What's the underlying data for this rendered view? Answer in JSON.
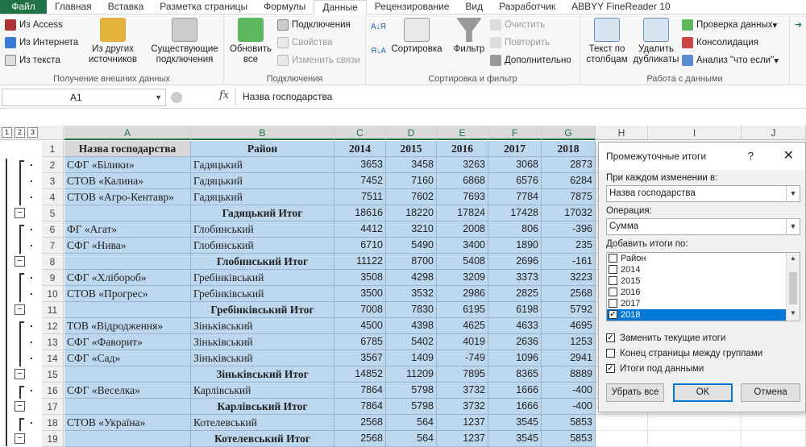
{
  "tabs": [
    "Файл",
    "Главная",
    "Вставка",
    "Разметка страницы",
    "Формулы",
    "Данные",
    "Рецензирование",
    "Вид",
    "Разработчик",
    "ABBYY FineReader 10"
  ],
  "ribbon": {
    "group1": {
      "label": "Получение внешних данных",
      "access": "Из Access",
      "internet": "Из Интернета",
      "text": "Из текста",
      "other": "Из других источников",
      "existing": "Существующие подключения"
    },
    "group2": {
      "label": "Подключения",
      "refresh": "Обновить все",
      "connections": "Подключения",
      "properties": "Свойства",
      "edit_links": "Изменить связи"
    },
    "group3": {
      "label": "Сортировка и фильтр",
      "sort": "Сортировка",
      "filter": "Фильтр",
      "clear": "Очистить",
      "reapply": "Повторить",
      "advanced": "Дополнительно"
    },
    "group4": {
      "label": "Работа с данными",
      "text_to_cols": "Текст по столбцам",
      "remove_dups": "Удалить дубликаты",
      "validation": "Проверка данных",
      "consolidate": "Консолидация",
      "whatif": "Анализ \"что если\""
    }
  },
  "formula_bar": {
    "name_box": "A1",
    "fx": "fx",
    "value": "Назва господарства"
  },
  "outline_levels": [
    "1",
    "2",
    "3"
  ],
  "columns": [
    "A",
    "B",
    "C",
    "D",
    "E",
    "F",
    "G",
    "H",
    "I",
    "J"
  ],
  "header_row": {
    "num": "1",
    "cells": [
      "Назва господарства",
      "Район",
      "2014",
      "2015",
      "2016",
      "2017",
      "2018"
    ]
  },
  "rows": [
    {
      "num": "2",
      "a": "СФГ «Білики»",
      "b": "Гадяцький",
      "v": [
        "3653",
        "3458",
        "3263",
        "3068",
        "2873"
      ],
      "total": false
    },
    {
      "num": "3",
      "a": "СТОВ «Калина»",
      "b": "Гадяцький",
      "v": [
        "7452",
        "7160",
        "6868",
        "6576",
        "6284"
      ],
      "total": false
    },
    {
      "num": "4",
      "a": "СТОВ «Агро-Кентавр»",
      "b": "Гадяцький",
      "v": [
        "7511",
        "7602",
        "7693",
        "7784",
        "7875"
      ],
      "total": false
    },
    {
      "num": "5",
      "a": "",
      "b": "Гадяцький Итог",
      "v": [
        "18616",
        "18220",
        "17824",
        "17428",
        "17032"
      ],
      "total": true
    },
    {
      "num": "6",
      "a": "ФГ «Агат»",
      "b": "Глобинський",
      "v": [
        "4412",
        "3210",
        "2008",
        "806",
        "-396"
      ],
      "total": false
    },
    {
      "num": "7",
      "a": "СФГ «Нива»",
      "b": "Глобинський",
      "v": [
        "6710",
        "5490",
        "3400",
        "1890",
        "235"
      ],
      "total": false
    },
    {
      "num": "8",
      "a": "",
      "b": "Глобинський Итог",
      "v": [
        "11122",
        "8700",
        "5408",
        "2696",
        "-161"
      ],
      "total": true
    },
    {
      "num": "9",
      "a": "СФГ «Хлібороб»",
      "b": "Гребінківський",
      "v": [
        "3508",
        "4298",
        "3209",
        "3373",
        "3223"
      ],
      "total": false
    },
    {
      "num": "10",
      "a": "СТОВ «Прогрес»",
      "b": "Гребінківський",
      "v": [
        "3500",
        "3532",
        "2986",
        "2825",
        "2568"
      ],
      "total": false
    },
    {
      "num": "11",
      "a": "",
      "b": "Гребінківський Итог",
      "v": [
        "7008",
        "7830",
        "6195",
        "6198",
        "5792"
      ],
      "total": true
    },
    {
      "num": "12",
      "a": "ТОВ «Відродження»",
      "b": "Зіньківський",
      "v": [
        "4500",
        "4398",
        "4625",
        "4633",
        "4695"
      ],
      "total": false
    },
    {
      "num": "13",
      "a": "СФГ «Фаворит»",
      "b": "Зіньківський",
      "v": [
        "6785",
        "5402",
        "4019",
        "2636",
        "1253"
      ],
      "total": false
    },
    {
      "num": "14",
      "a": "СФГ «Сад»",
      "b": "Зіньківський",
      "v": [
        "3567",
        "1409",
        "-749",
        "1096",
        "2941"
      ],
      "total": false
    },
    {
      "num": "15",
      "a": "",
      "b": "Зіньківський Итог",
      "v": [
        "14852",
        "11209",
        "7895",
        "8365",
        "8889"
      ],
      "total": true
    },
    {
      "num": "16",
      "a": "СФГ «Веселка»",
      "b": "Карлівський",
      "v": [
        "7864",
        "5798",
        "3732",
        "1666",
        "-400"
      ],
      "total": false
    },
    {
      "num": "17",
      "a": "",
      "b": "Карлівський Итог",
      "v": [
        "7864",
        "5798",
        "3732",
        "1666",
        "-400"
      ],
      "total": true
    },
    {
      "num": "18",
      "a": "СТОВ «Україна»",
      "b": "Котелевський",
      "v": [
        "2568",
        "564",
        "1237",
        "3545",
        "5853"
      ],
      "total": false
    },
    {
      "num": "19",
      "a": "",
      "b": "Котелевський Итог",
      "v": [
        "2568",
        "564",
        "1237",
        "3545",
        "5853"
      ],
      "total": true
    }
  ],
  "dialog": {
    "title": "Промежуточные итоги",
    "help": "?",
    "close": "✕",
    "group_label": "При каждом изменении в:",
    "group_value": "Назва господарства",
    "op_label": "Операция:",
    "op_value": "Сумма",
    "add_label": "Добавить итоги по:",
    "list": [
      {
        "label": "Район",
        "checked": false
      },
      {
        "label": "2014",
        "checked": false
      },
      {
        "label": "2015",
        "checked": false
      },
      {
        "label": "2016",
        "checked": false
      },
      {
        "label": "2017",
        "checked": false
      },
      {
        "label": "2018",
        "checked": true
      }
    ],
    "replace": "Заменить текущие итоги",
    "pagebreak": "Конец страницы между группами",
    "below": "Итоги под данными",
    "replace_checked": true,
    "pagebreak_checked": false,
    "below_checked": true,
    "remove_all": "Убрать все",
    "ok": "OK",
    "cancel": "Отмена"
  }
}
